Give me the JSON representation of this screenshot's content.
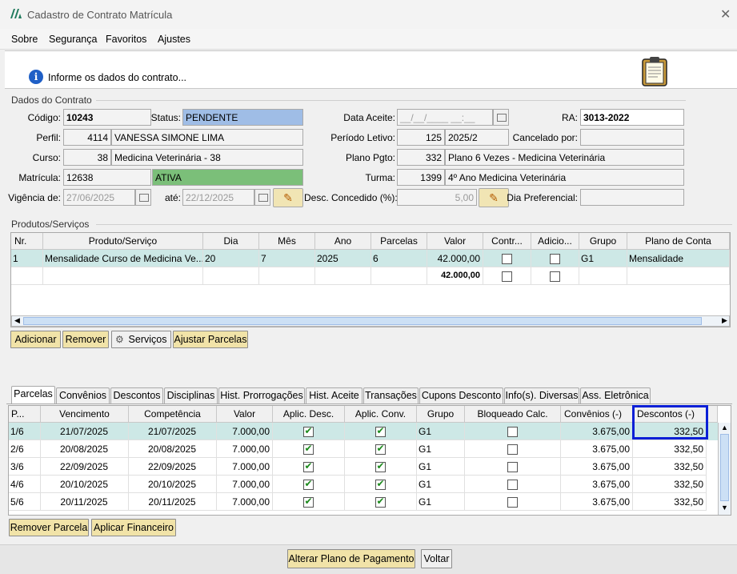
{
  "window": {
    "title": "Cadastro de Contrato Matrícula",
    "close": "✕"
  },
  "menu": [
    "Sobre",
    "Segurança",
    "Favoritos",
    "Ajustes"
  ],
  "info": {
    "icon": "info-icon",
    "text": "Informe os dados do contrato..."
  },
  "contrato": {
    "section_title": "Dados do Contrato",
    "codigo_label": "Código:",
    "codigo": "10243",
    "status_label": "Status:",
    "status": "PENDENTE",
    "data_aceite_label": "Data Aceite:",
    "data_aceite": "__/__/____ __:__",
    "ra_label": "RA:",
    "ra": "3013-2022",
    "perfil_label": "Perfil:",
    "perfil_id": "4114",
    "perfil_nome": "VANESSA SIMONE LIMA",
    "periodo_label": "Período Letivo:",
    "periodo_id": "125",
    "periodo_nome": "2025/2",
    "cancelado_label": "Cancelado por:",
    "cancelado": "",
    "curso_label": "Curso:",
    "curso_id": "38",
    "curso_nome": "Medicina Veterinária - 38",
    "plano_label": "Plano Pgto:",
    "plano_id": "332",
    "plano_nome": "Plano 6 Vezes - Medicina Veterinária",
    "matricula_label": "Matrícula:",
    "matricula": "12638",
    "matricula_status": "ATIVA",
    "turma_label": "Turma:",
    "turma_id": "1399",
    "turma_nome": "4º Ano Medicina Veterinária",
    "vigencia_label": "Vigência de:",
    "vigencia_de": "27/06/2025",
    "ate_label": "até:",
    "vigencia_ate": "22/12/2025",
    "desconto_label": "Desc. Concedido (%):",
    "desconto": "5,00",
    "dia_pref_label": "Dia Preferencial:",
    "dia_pref": ""
  },
  "produtos": {
    "section_title": "Produtos/Serviços",
    "columns": [
      "Nr.",
      "Produto/Serviço",
      "Dia",
      "Mês",
      "Ano",
      "Parcelas",
      "Valor",
      "Contr...",
      "Adicio...",
      "Grupo",
      "Plano de Conta"
    ],
    "rows": [
      {
        "nr": "1",
        "produto": "Mensalidade Curso de Medicina Ve...",
        "dia": "20",
        "mes": "7",
        "ano": "2025",
        "parcelas": "6",
        "valor": "42.000,00",
        "contr": false,
        "adic": false,
        "grupo": "G1",
        "plano": "Mensalidade"
      }
    ],
    "total": "42.000,00",
    "buttons": {
      "adicionar": "Adicionar",
      "remover": "Remover",
      "servicos": "Serviços",
      "ajustar": "Ajustar Parcelas"
    }
  },
  "tabs": [
    "Parcelas",
    "Convênios",
    "Descontos",
    "Disciplinas",
    "Hist. Prorrogações",
    "Hist. Aceite",
    "Transações",
    "Cupons Desconto",
    "Info(s). Diversas",
    "Ass. Eletrônica"
  ],
  "active_tab": "Parcelas",
  "parcelas": {
    "columns": [
      "P...",
      "Vencimento",
      "Competência",
      "Valor",
      "Aplic. Desc.",
      "Aplic. Conv.",
      "Grupo",
      "Bloqueado Calc.",
      "Convênios (-)",
      "Descontos (-)"
    ],
    "rows": [
      {
        "p": "1/6",
        "venc": "21/07/2025",
        "comp": "21/07/2025",
        "valor": "7.000,00",
        "desc": true,
        "conv": true,
        "grupo": "G1",
        "bloq": false,
        "convenios": "3.675,00",
        "descontos": "332,50"
      },
      {
        "p": "2/6",
        "venc": "20/08/2025",
        "comp": "20/08/2025",
        "valor": "7.000,00",
        "desc": true,
        "conv": true,
        "grupo": "G1",
        "bloq": false,
        "convenios": "3.675,00",
        "descontos": "332,50"
      },
      {
        "p": "3/6",
        "venc": "22/09/2025",
        "comp": "22/09/2025",
        "valor": "7.000,00",
        "desc": true,
        "conv": true,
        "grupo": "G1",
        "bloq": false,
        "convenios": "3.675,00",
        "descontos": "332,50"
      },
      {
        "p": "4/6",
        "venc": "20/10/2025",
        "comp": "20/10/2025",
        "valor": "7.000,00",
        "desc": true,
        "conv": true,
        "grupo": "G1",
        "bloq": false,
        "convenios": "3.675,00",
        "descontos": "332,50"
      },
      {
        "p": "5/6",
        "venc": "20/11/2025",
        "comp": "20/11/2025",
        "valor": "7.000,00",
        "desc": true,
        "conv": true,
        "grupo": "G1",
        "bloq": false,
        "convenios": "3.675,00",
        "descontos": "332,50"
      }
    ],
    "buttons": {
      "remover": "Remover Parcela",
      "aplicar": "Aplicar Financeiro"
    }
  },
  "footer": {
    "alterar": "Alterar Plano de Pagamento",
    "voltar": "Voltar"
  },
  "colors": {
    "status_bg": "#9fbde6",
    "ativa_bg": "#7bbf79",
    "selected_row": "#cde8e6",
    "button_bg": "#f1e3a8",
    "highlight_border": "#0a1fd6"
  }
}
